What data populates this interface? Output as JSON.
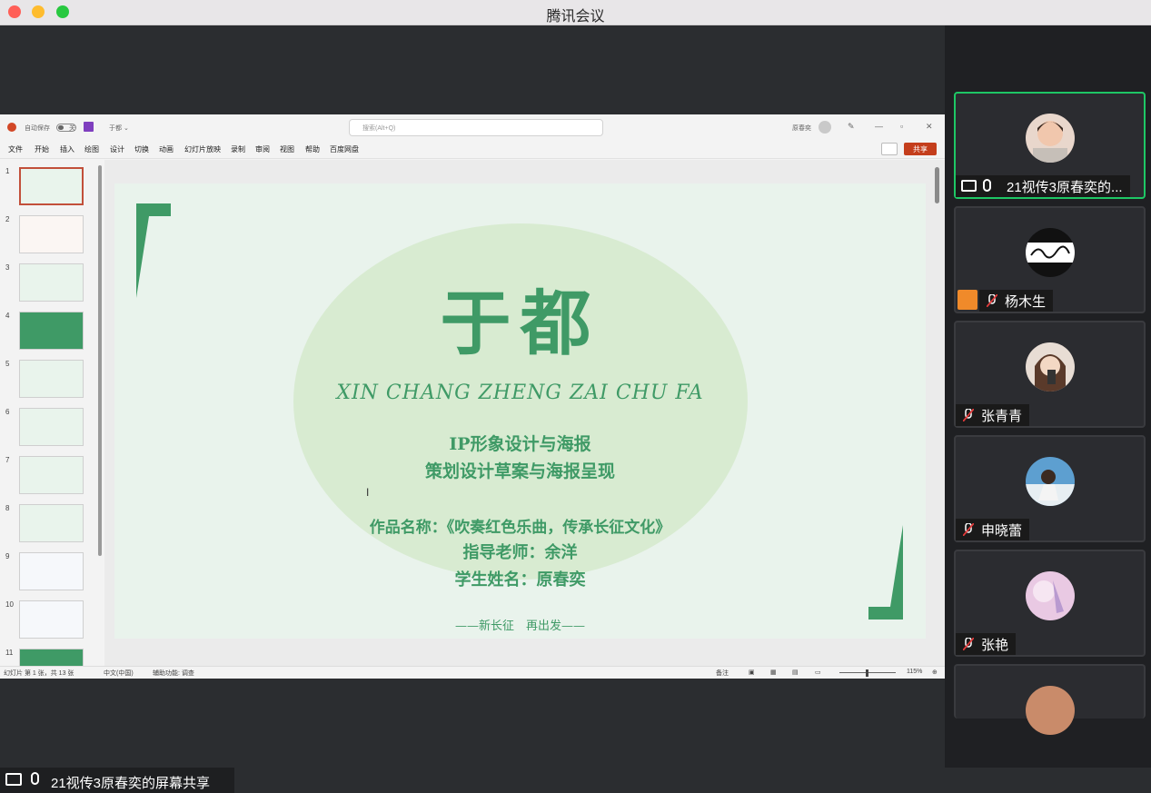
{
  "window": {
    "title": "腾讯会议"
  },
  "ppt": {
    "autosave_label": "自动保存",
    "autosave_state": "关",
    "file_name": "于都 ⌄",
    "search_placeholder": "搜索(Alt+Q)",
    "user_name": "原春奕",
    "ribbon": [
      "文件",
      "开始",
      "插入",
      "绘图",
      "设计",
      "切换",
      "动画",
      "幻灯片放映",
      "录制",
      "审阅",
      "视图",
      "帮助",
      "百度网盘"
    ],
    "share_label": "共享",
    "thumbnails": [
      "1",
      "2",
      "3",
      "4",
      "5",
      "6",
      "7",
      "8",
      "9",
      "10",
      "11"
    ],
    "slide": {
      "title": "于都",
      "subtitle": "XIN CHANG ZHENG ZAI CHU FA",
      "line1": "IP形象设计与海报",
      "line2": "策划设计草案与海报呈现",
      "work_name": "作品名称：《吹奏红色乐曲，传承长征文化》",
      "teacher": "指导老师：余洋",
      "student": "学生姓名：原春奕",
      "footer": "——新长征　再出发——"
    },
    "status": {
      "slide_info": "幻灯片 第 1 张，共 13 张",
      "language": "中文(中国)",
      "accessibility": "辅助功能: 调查",
      "notes": "备注",
      "zoom": "115%"
    }
  },
  "share_bar": {
    "label": "21视传3原春奕的屏幕共享"
  },
  "participants": [
    {
      "name": "21视传3原春奕的...",
      "mic": "on",
      "active": true,
      "sharing": true
    },
    {
      "name": "杨木生",
      "mic": "muted",
      "active": false
    },
    {
      "name": "张青青",
      "mic": "muted",
      "active": false
    },
    {
      "name": "申晓蕾",
      "mic": "muted",
      "active": false
    },
    {
      "name": "张艳",
      "mic": "muted",
      "active": false
    }
  ],
  "colors": {
    "accent_green": "#3f9a66",
    "active_border": "#1ec765",
    "share_btn": "#c43e1c"
  }
}
